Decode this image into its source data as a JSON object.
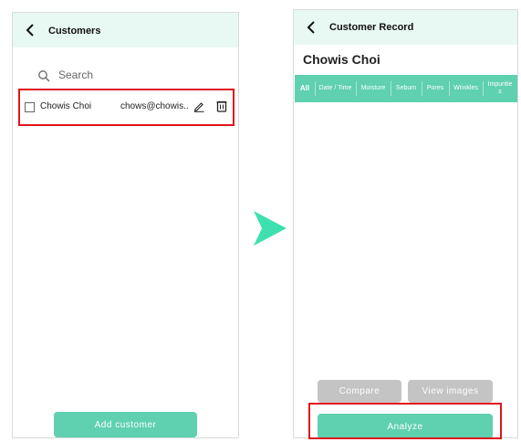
{
  "left": {
    "title": "Customers",
    "search_placeholder": "Search",
    "customer": {
      "name": "Chowis Choi",
      "email": "chows@chowis.."
    },
    "add_button": "Add customer"
  },
  "right": {
    "title": "Customer Record",
    "customer_name": "Chowis Choi",
    "tabs": [
      "All",
      "Date / Time",
      "Moisture",
      "Sebum",
      "Pores",
      "Wrinkles",
      "Impuritie\ns"
    ],
    "compare_button": "Compare",
    "view_images_button": "View images",
    "analyze_button": "Analyze"
  },
  "colors": {
    "accent": "#5fd0b0",
    "header_bg": "#e8f8f2",
    "disabled": "#c4c4c4",
    "highlight": "#e0141e",
    "arrow": "#3fe0b0"
  }
}
